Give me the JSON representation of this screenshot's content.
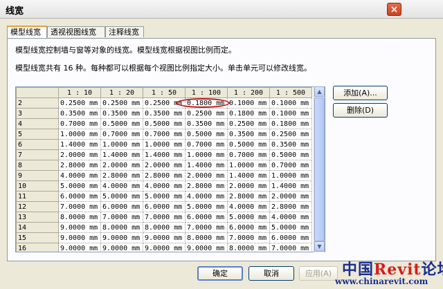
{
  "dialog": {
    "title": "线宽",
    "close_label": "×"
  },
  "tabs": [
    {
      "label": "模型线宽",
      "active": true
    },
    {
      "label": "透视视图线宽",
      "active": false
    },
    {
      "label": "注释线宽",
      "active": false
    }
  ],
  "descriptions": {
    "line1": "模型线宽控制墙与窗等对象的线宽。模型线宽根据视图比例而定。",
    "line2": "模型线宽共有 16 种。每种都可以根据每个视图比例指定大小。单击单元可以修改线宽。"
  },
  "table": {
    "columns": [
      "1 : 10",
      "1 : 20",
      "1 : 50",
      "1 : 100",
      "1 : 200",
      "1 : 500"
    ],
    "rows": [
      {
        "pen": "2",
        "cells": [
          "0.2500 mm",
          "0.2500 mm",
          "0.2500 mm",
          "0.1800 mm",
          "0.1000 mm",
          "0.1000 mm"
        ]
      },
      {
        "pen": "3",
        "cells": [
          "0.3500 mm",
          "0.3500 mm",
          "0.3500 mm",
          "0.2500 mm",
          "0.1800 mm",
          "0.1000 mm"
        ]
      },
      {
        "pen": "4",
        "cells": [
          "0.7000 mm",
          "0.5000 mm",
          "0.5000 mm",
          "0.3500 mm",
          "0.2500 mm",
          "0.1800 mm"
        ]
      },
      {
        "pen": "5",
        "cells": [
          "1.0000 mm",
          "0.7000 mm",
          "0.7000 mm",
          "0.5000 mm",
          "0.3500 mm",
          "0.2500 mm"
        ]
      },
      {
        "pen": "6",
        "cells": [
          "1.4000 mm",
          "1.0000 mm",
          "1.0000 mm",
          "0.7000 mm",
          "0.5000 mm",
          "0.3500 mm"
        ]
      },
      {
        "pen": "7",
        "cells": [
          "2.0000 mm",
          "1.4000 mm",
          "1.4000 mm",
          "1.0000 mm",
          "0.7000 mm",
          "0.5000 mm"
        ]
      },
      {
        "pen": "8",
        "cells": [
          "2.8000 mm",
          "2.0000 mm",
          "2.0000 mm",
          "1.4000 mm",
          "1.0000 mm",
          "0.7000 mm"
        ]
      },
      {
        "pen": "9",
        "cells": [
          "4.0000 mm",
          "2.8000 mm",
          "2.8000 mm",
          "2.0000 mm",
          "1.4000 mm",
          "1.0000 mm"
        ]
      },
      {
        "pen": "10",
        "cells": [
          "5.0000 mm",
          "4.0000 mm",
          "4.0000 mm",
          "2.8000 mm",
          "2.0000 mm",
          "1.4000 mm"
        ]
      },
      {
        "pen": "11",
        "cells": [
          "6.0000 mm",
          "5.0000 mm",
          "5.0000 mm",
          "4.0000 mm",
          "2.8000 mm",
          "2.0000 mm"
        ]
      },
      {
        "pen": "12",
        "cells": [
          "7.0000 mm",
          "6.0000 mm",
          "6.0000 mm",
          "5.0000 mm",
          "4.0000 mm",
          "2.8000 mm"
        ]
      },
      {
        "pen": "13",
        "cells": [
          "8.0000 mm",
          "7.0000 mm",
          "7.0000 mm",
          "6.0000 mm",
          "5.0000 mm",
          "4.0000 mm"
        ]
      },
      {
        "pen": "14",
        "cells": [
          "9.0000 mm",
          "8.0000 mm",
          "8.0000 mm",
          "7.0000 mm",
          "6.0000 mm",
          "5.0000 mm"
        ]
      },
      {
        "pen": "15",
        "cells": [
          "9.0000 mm",
          "9.0000 mm",
          "9.0000 mm",
          "8.0000 mm",
          "7.0000 mm",
          "6.0000 mm"
        ]
      },
      {
        "pen": "16",
        "cells": [
          "9.0000 mm",
          "9.0000 mm",
          "9.0000 mm",
          "9.0000 mm",
          "8.0000 mm",
          "7.0000 mm"
        ]
      }
    ]
  },
  "side_buttons": {
    "add": "添加(A)...",
    "delete": "删除(D)"
  },
  "footer_buttons": {
    "ok": "确定",
    "cancel": "取消",
    "apply": "应用(A)"
  },
  "scroll_icons": {
    "up": "▲",
    "down": "▼"
  },
  "watermark": {
    "brand_prefix": "中国",
    "brand_mid": "Revit",
    "brand_suffix": "论坛",
    "url": "www.chinarevit.com"
  },
  "colors": {
    "accent_tab": "#e6a23c",
    "highlight": "#c41a1a",
    "close_button": "#c8421f"
  }
}
